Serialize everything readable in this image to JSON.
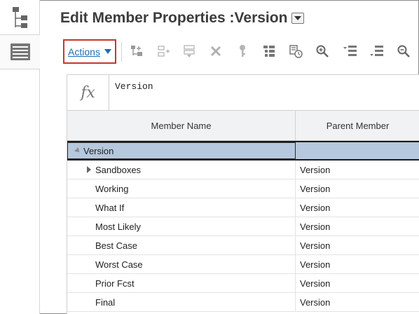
{
  "header": {
    "title": "Edit Member Properties :Version"
  },
  "toolbar": {
    "actions_label": "Actions"
  },
  "formula_bar": {
    "icon_label": "fx",
    "value": "Version"
  },
  "grid": {
    "columns": [
      "Member Name",
      "Parent Member"
    ],
    "rows": [
      {
        "name": "Version",
        "parent": ""
      },
      {
        "name": "Sandboxes",
        "parent": "Version"
      },
      {
        "name": "Working",
        "parent": "Version"
      },
      {
        "name": "What If",
        "parent": "Version"
      },
      {
        "name": "Most Likely",
        "parent": "Version"
      },
      {
        "name": "Best Case",
        "parent": "Version"
      },
      {
        "name": "Worst Case",
        "parent": "Version"
      },
      {
        "name": "Prior Fcst",
        "parent": "Version"
      },
      {
        "name": "Final",
        "parent": "Version"
      }
    ]
  },
  "colors": {
    "accent": "#1b6db4",
    "highlight_border": "#c23a2b",
    "selected_row": "#b6c8dd"
  }
}
